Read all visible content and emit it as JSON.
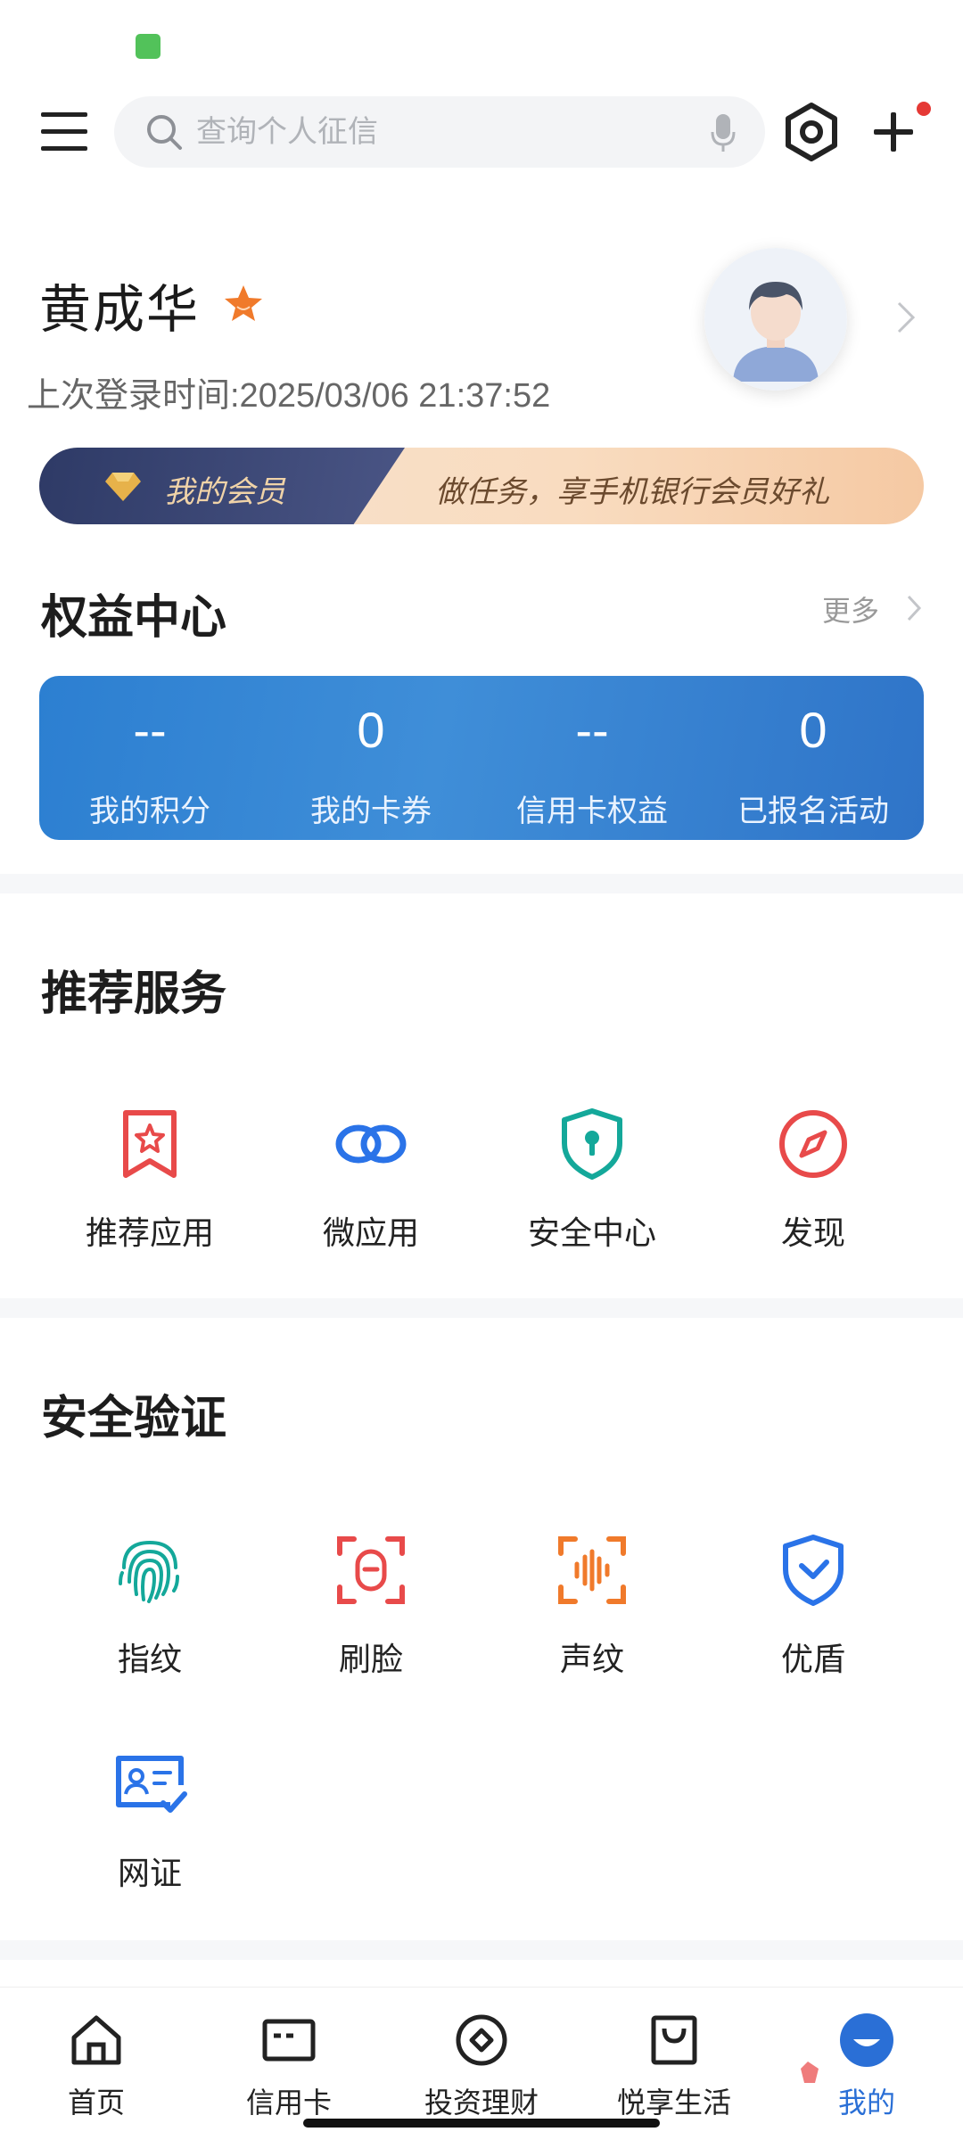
{
  "search": {
    "placeholder": "查询个人征信"
  },
  "profile": {
    "name": "黄成华",
    "last_login": "上次登录时间:2025/03/06 21:37:52"
  },
  "member_banner": {
    "label": "我的会员",
    "slogan": "做任务，享手机银行会员好礼"
  },
  "rights_center": {
    "title": "权益中心",
    "more": "更多",
    "items": [
      {
        "value": "--",
        "label": "我的积分"
      },
      {
        "value": "0",
        "label": "我的卡券"
      },
      {
        "value": "--",
        "label": "信用卡权益"
      },
      {
        "value": "0",
        "label": "已报名活动"
      }
    ]
  },
  "recommended": {
    "title": "推荐服务",
    "items": [
      {
        "label": "推荐应用",
        "icon": "bookmark-star-icon",
        "color": "#e84a4a"
      },
      {
        "label": "微应用",
        "icon": "link-rings-icon",
        "color": "#2a73e8"
      },
      {
        "label": "安全中心",
        "icon": "shield-keyhole-icon",
        "color": "#14a89a"
      },
      {
        "label": "发现",
        "icon": "compass-icon",
        "color": "#e84a4a"
      }
    ]
  },
  "security": {
    "title": "安全验证",
    "items": [
      {
        "label": "指纹",
        "icon": "fingerprint-icon",
        "color": "#14a89a"
      },
      {
        "label": "刷脸",
        "icon": "face-scan-icon",
        "color": "#e84a4a"
      },
      {
        "label": "声纹",
        "icon": "voiceprint-icon",
        "color": "#f07a2b"
      },
      {
        "label": "优盾",
        "icon": "shield-check-icon",
        "color": "#2a73e8"
      },
      {
        "label": "网证",
        "icon": "id-card-check-icon",
        "color": "#2a73e8"
      }
    ]
  },
  "tabbar": {
    "items": [
      {
        "label": "首页",
        "icon": "home-icon"
      },
      {
        "label": "信用卡",
        "icon": "credit-card-icon"
      },
      {
        "label": "投资理财",
        "icon": "investment-icon"
      },
      {
        "label": "悦享生活",
        "icon": "shopping-bag-icon"
      },
      {
        "label": "我的",
        "icon": "profile-tab-icon",
        "active": true
      }
    ]
  },
  "colors": {
    "accent": "#2a6fd6",
    "rights_card": "#2f7fd0",
    "member_dark": "#2e3a66",
    "notification": "#e53935"
  }
}
